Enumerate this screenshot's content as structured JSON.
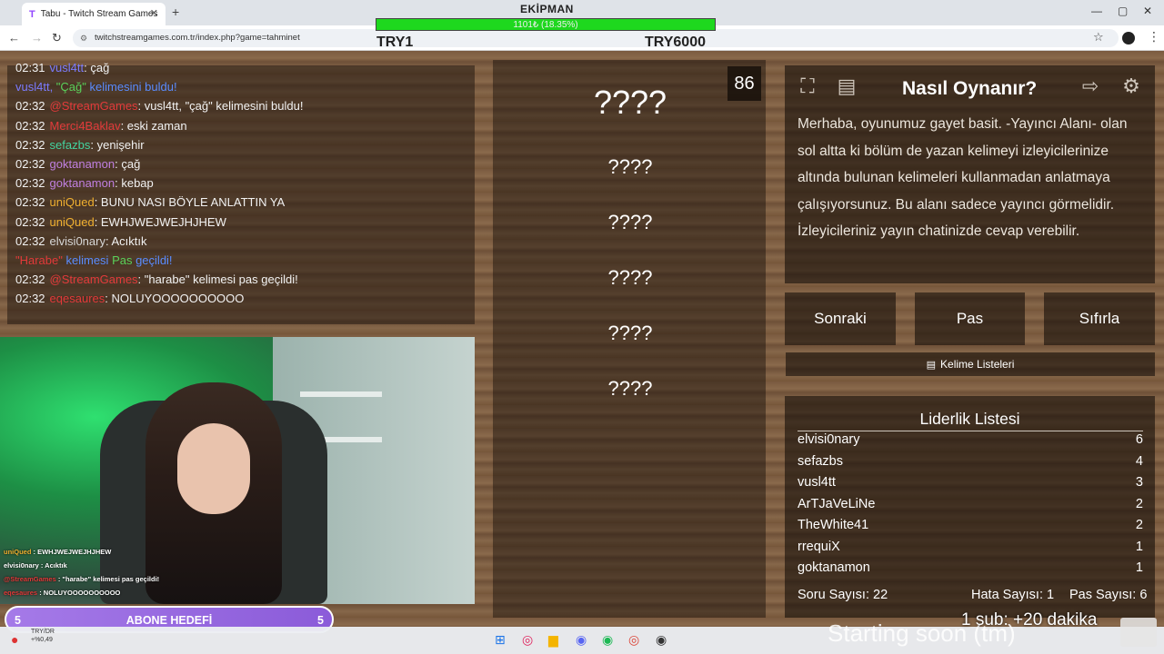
{
  "browser": {
    "tab_title": "Tabu - Twitch Stream Games",
    "tab_icon": "T",
    "url": "twitchstreamgames.com.tr/index.php?game=tahminet"
  },
  "overlay": {
    "ekipman_label": "EKİPMAN",
    "ekipman_progress_text": "1101₺ (18.35%)",
    "ekipman_progress": 18.35,
    "try_left": "TRY1",
    "try_right": "TRY6000"
  },
  "chat": [
    {
      "time": "02:31",
      "user": "vusl4tt",
      "user_color": "#7c7cff",
      "msg": ": çağ"
    },
    {
      "time": "",
      "user": "vusl4tt,",
      "user_color": "#7c7cff",
      "special": true,
      "parts": [
        {
          "t": " \"Çağ\" ",
          "c": "#5ad15a"
        },
        {
          "t": "kelimesini buldu!",
          "c": "#5a8cff"
        }
      ]
    },
    {
      "time": "02:32",
      "user": "@StreamGames",
      "user_color": "#e23a3a",
      "msg": ": vusl4tt, \"çağ\" kelimesini buldu!"
    },
    {
      "time": "02:32",
      "user": "Merci4Baklav",
      "user_color": "#e23a3a",
      "msg": ": eski zaman"
    },
    {
      "time": "02:32",
      "user": "sefazbs",
      "user_color": "#44d4a0",
      "msg": ": yenişehir"
    },
    {
      "time": "02:32",
      "user": "goktanamon",
      "user_color": "#c07fe0",
      "msg": ": çağ"
    },
    {
      "time": "02:32",
      "user": "goktanamon",
      "user_color": "#c07fe0",
      "msg": ": kebap"
    },
    {
      "time": "02:32",
      "user": "uniQued",
      "user_color": "#f0b030",
      "msg": ": BUNU NASI BÖYLE ANLATTIN YA"
    },
    {
      "time": "02:32",
      "user": "uniQued",
      "user_color": "#f0b030",
      "msg": ": EWHJWEJWEJHJHEW"
    },
    {
      "time": "02:32",
      "user": "elvisi0nary",
      "user_color": "#d8d8d8",
      "msg": ": Acıktık"
    },
    {
      "time": "",
      "user": "\"Harabe\"",
      "user_color": "#e23a3a",
      "special": true,
      "parts": [
        {
          "t": " kelimesi ",
          "c": "#5a8cff"
        },
        {
          "t": "Pas",
          "c": "#5ad15a"
        },
        {
          "t": " geçildi!",
          "c": "#5a8cff"
        }
      ]
    },
    {
      "time": "02:32",
      "user": "@StreamGames",
      "user_color": "#e23a3a",
      "msg": ": \"harabe\" kelimesi pas geçildi!"
    },
    {
      "time": "02:32",
      "user": "eqesaures",
      "user_color": "#e23a3a",
      "msg": ": NOLUYOOOOOOOOOO"
    }
  ],
  "cam_chat": [
    {
      "user": "uniQued",
      "color": "#f0b030",
      "msg": " : EWHJWEJWEJHJHEW"
    },
    {
      "user": "elvisi0nary",
      "color": "#ffffff",
      "msg": " : Acıktık"
    },
    {
      "user": "@StreamGames",
      "color": "#e23a3a",
      "msg": " : \"harabe\" kelimesi pas geçildi!"
    },
    {
      "user": "eqesaures",
      "color": "#e23a3a",
      "msg": " : NOLUYOOOOOOOOOO"
    }
  ],
  "abone": {
    "left": "5",
    "label": "ABONE HEDEFİ",
    "right": "5"
  },
  "game": {
    "counter": "86",
    "main_word": "????",
    "taboo_words": [
      "????",
      "????",
      "????",
      "????",
      "????"
    ]
  },
  "how_to": {
    "title": "Nasıl Oynanır?",
    "text": "Merhaba, oyunumuz gayet basit. -Yayıncı Alanı- olan sol altta ki bölüm de yazan kelimeyi izleyicilerinize altında bulunan kelimeleri kullanmadan anlatmaya çalışıyorsunuz. Bu alanı sadece yayıncı görmelidir. İzleyicileriniz yayın chatinizde cevap verebilir."
  },
  "buttons": {
    "next": "Sonraki",
    "pass": "Pas",
    "reset": "Sıfırla",
    "word_lists": "Kelime Listeleri"
  },
  "leaderboard": {
    "title": "Liderlik Listesi",
    "rows": [
      {
        "name": "elvisi0nary",
        "score": "6"
      },
      {
        "name": "sefazbs",
        "score": "4"
      },
      {
        "name": "vusl4tt",
        "score": "3"
      },
      {
        "name": "ArTJaVeLiNe",
        "score": "2"
      },
      {
        "name": "TheWhite41",
        "score": "2"
      },
      {
        "name": "rrequiX",
        "score": "1"
      },
      {
        "name": "goktanamon",
        "score": "1"
      }
    ],
    "soru_label": "Soru Sayısı: 22",
    "hata_label": "Hata Sayısı: 1",
    "pas_label": "Pas Sayısı: 6"
  },
  "stream_footer": {
    "starting": "Starting soon (tm)",
    "sub": "1 sub: +20 dakika"
  },
  "taskbar": {
    "weather_line1": "TRY/DR",
    "weather_line2": "+%0,49"
  }
}
